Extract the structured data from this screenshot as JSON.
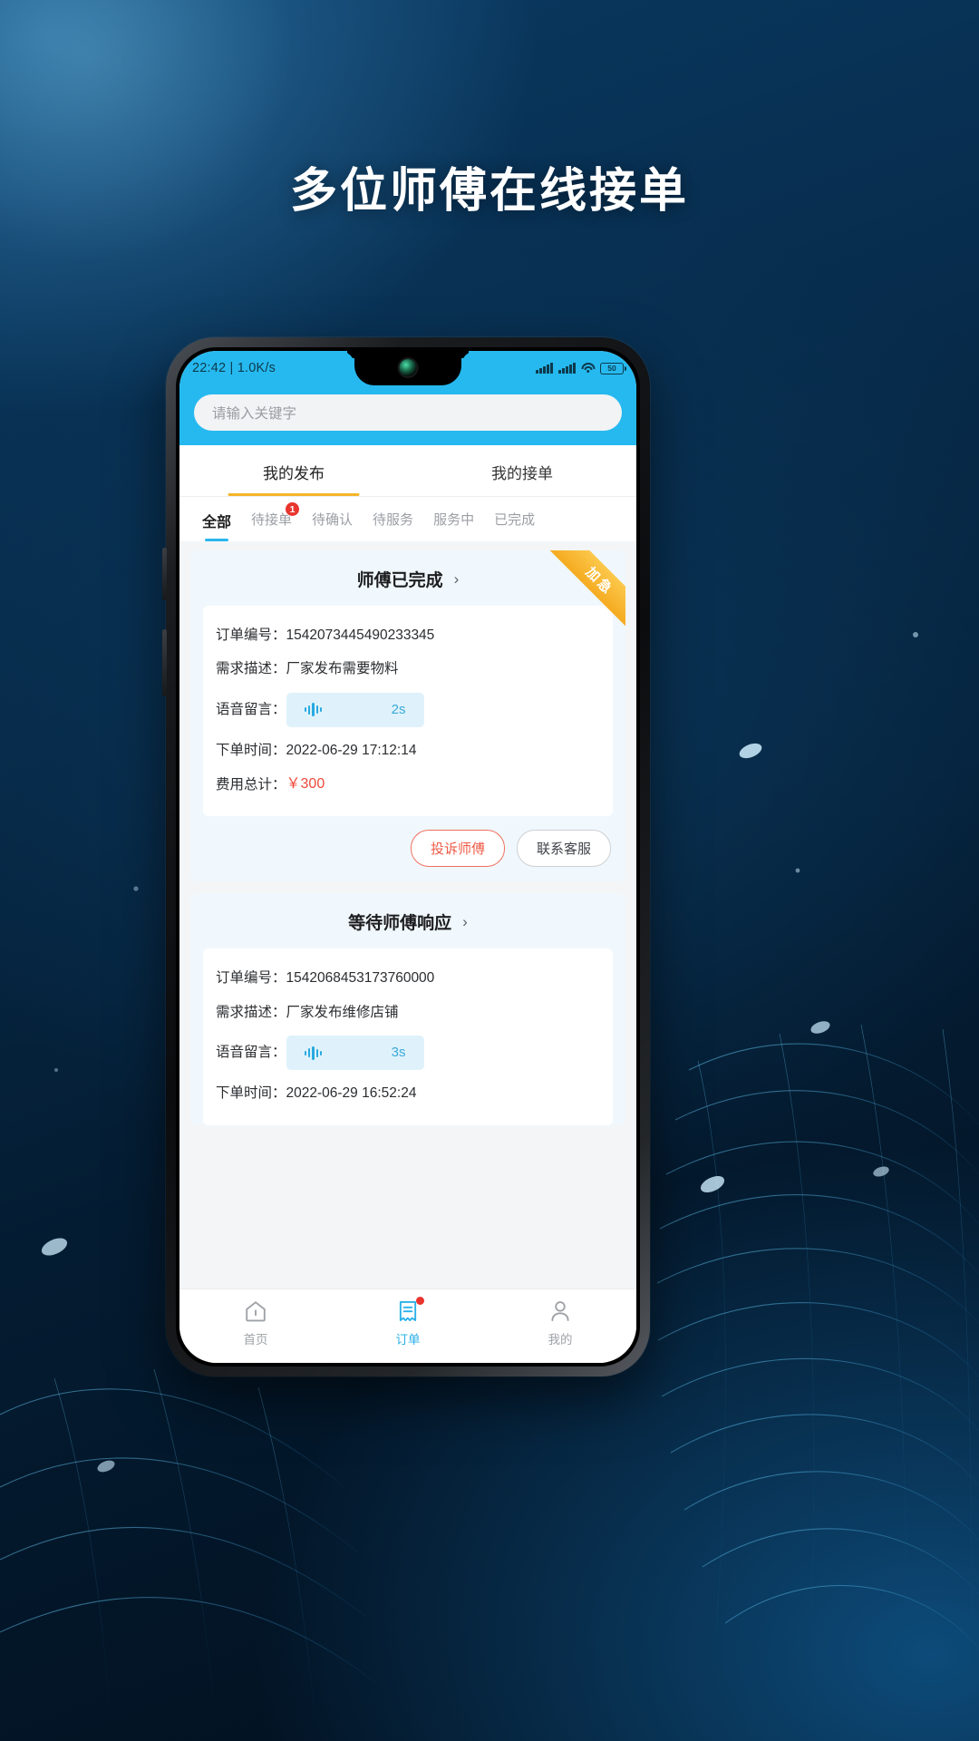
{
  "headline": "多位师傅在线接单",
  "statusbar": {
    "time_net": "22:42 | 1.0K/s",
    "battery": "50"
  },
  "search": {
    "placeholder": "请输入关键字"
  },
  "main_tabs": [
    {
      "label": "我的发布",
      "active": true
    },
    {
      "label": "我的接单",
      "active": false
    }
  ],
  "filter_tabs": [
    {
      "label": "全部",
      "active": true,
      "badge": ""
    },
    {
      "label": "待接单",
      "active": false,
      "badge": "1"
    },
    {
      "label": "待确认",
      "active": false,
      "badge": ""
    },
    {
      "label": "待服务",
      "active": false,
      "badge": ""
    },
    {
      "label": "服务中",
      "active": false,
      "badge": ""
    },
    {
      "label": "已完成",
      "active": false,
      "badge": ""
    }
  ],
  "cards": [
    {
      "status": "师傅已完成",
      "chevron": "›",
      "ribbon": "加急",
      "order_label": "订单编号：",
      "order_value": "1542073445490233345",
      "desc_label": "需求描述：",
      "desc_value": "厂家发布需要物料",
      "voice_label": "语音留言：",
      "voice_duration": "2s",
      "time_label": "下单时间：",
      "time_value": "2022-06-29 17:12:14",
      "fee_label": "费用总计：",
      "fee_value": "￥300",
      "actions": [
        {
          "label": "投诉师傅",
          "style": "warn"
        },
        {
          "label": "联系客服",
          "style": "plain"
        }
      ]
    },
    {
      "status": "等待师傅响应",
      "chevron": "›",
      "ribbon": "",
      "order_label": "订单编号：",
      "order_value": "1542068453173760000",
      "desc_label": "需求描述：",
      "desc_value": "厂家发布维修店铺",
      "voice_label": "语音留言：",
      "voice_duration": "3s",
      "time_label": "下单时间：",
      "time_value": "2022-06-29 16:52:24",
      "fee_label": "",
      "fee_value": "",
      "actions": []
    }
  ],
  "bottom_nav": [
    {
      "label": "首页",
      "active": false,
      "dot": false
    },
    {
      "label": "订单",
      "active": true,
      "dot": true
    },
    {
      "label": "我的",
      "active": false,
      "dot": false
    }
  ],
  "colors": {
    "accent": "#26b9ef",
    "ribbon": "#f5ab21",
    "badge": "#e8352e",
    "price": "#ef4a3a",
    "tab_underline": "#f4b52b"
  }
}
